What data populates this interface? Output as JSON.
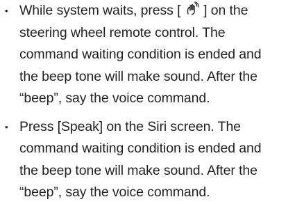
{
  "items": [
    {
      "first_before_icon": "While system waits, press [ ",
      "icon": "voice-recognition-hand-icon",
      "first_after_icon": " ] on the",
      "lines": [
        "steering wheel remote control. The",
        "command waiting condition is ended and",
        "the beep tone will make sound. After the",
        "“beep”, say the voice command."
      ]
    },
    {
      "lines": [
        "Press [Speak] on the Siri screen. The",
        "command waiting condition is ended and",
        "the beep tone will make sound. After the",
        "“beep”, say the voice command."
      ]
    }
  ]
}
